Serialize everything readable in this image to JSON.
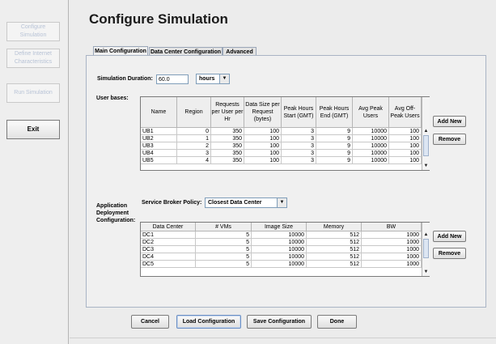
{
  "sidebar": {
    "items": [
      {
        "label": "Configure Simulation"
      },
      {
        "label": "Define Internet Characteristics"
      },
      {
        "label": "Run Simulation"
      },
      {
        "label": "Exit"
      }
    ]
  },
  "page": {
    "title": "Configure Simulation"
  },
  "tabs": [
    {
      "label": "Main Configuration"
    },
    {
      "label": "Data Center Configuration"
    },
    {
      "label": "Advanced"
    }
  ],
  "simulation": {
    "duration_label": "Simulation Duration:",
    "duration_value": "60.0",
    "unit": "hours"
  },
  "user_bases": {
    "label": "User bases:",
    "columns": [
      "Name",
      "Region",
      "Requests per User per Hr",
      "Data Size per Request (bytes)",
      "Peak Hours Start (GMT)",
      "Peak Hours End (GMT)",
      "Avg Peak Users",
      "Avg Off-Peak Users"
    ],
    "rows": [
      [
        "UB1",
        "0",
        "350",
        "100",
        "3",
        "9",
        "10000",
        "100"
      ],
      [
        "UB2",
        "1",
        "350",
        "100",
        "3",
        "9",
        "10000",
        "100"
      ],
      [
        "UB3",
        "2",
        "350",
        "100",
        "3",
        "9",
        "10000",
        "100"
      ],
      [
        "UB4",
        "3",
        "350",
        "100",
        "3",
        "9",
        "10000",
        "100"
      ],
      [
        "UB5",
        "4",
        "350",
        "100",
        "3",
        "9",
        "10000",
        "100"
      ]
    ],
    "add_label": "Add New",
    "remove_label": "Remove"
  },
  "deployment": {
    "label_line1": "Application",
    "label_line2": "Deployment",
    "label_line3": "Configuration:",
    "broker_label": "Service Broker Policy:",
    "broker_value": "Closest Data Center",
    "columns": [
      "Data Center",
      "# VMs",
      "Image Size",
      "Memory",
      "BW"
    ],
    "rows": [
      [
        "DC1",
        "5",
        "10000",
        "512",
        "1000"
      ],
      [
        "DC2",
        "5",
        "10000",
        "512",
        "1000"
      ],
      [
        "DC3",
        "5",
        "10000",
        "512",
        "1000"
      ],
      [
        "DC4",
        "5",
        "10000",
        "512",
        "1000"
      ],
      [
        "DC5",
        "5",
        "10000",
        "512",
        "1000"
      ]
    ],
    "add_label": "Add New",
    "remove_label": "Remove"
  },
  "footer": {
    "cancel": "Cancel",
    "load": "Load Configuration",
    "save": "Save Configuration",
    "done": "Done"
  }
}
